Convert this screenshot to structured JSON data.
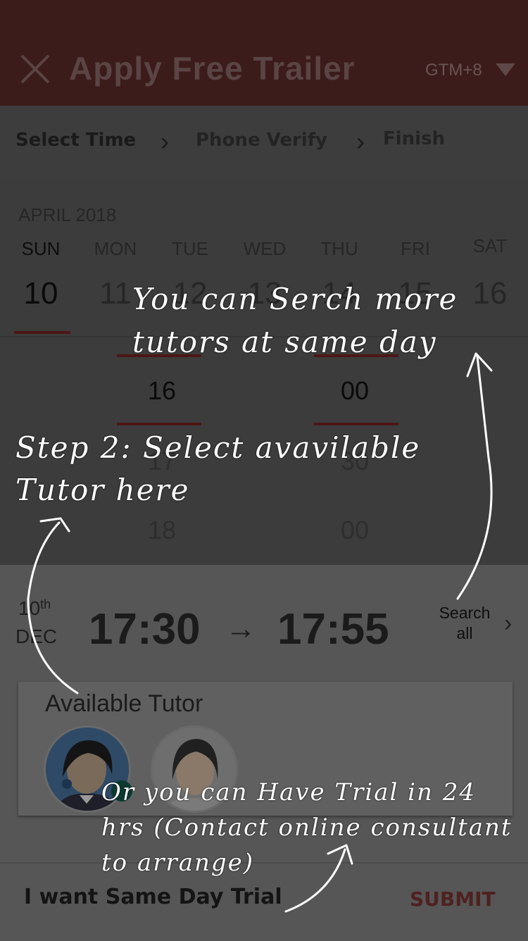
{
  "header": {
    "title": "Apply Free Trailer",
    "timezone": "GTM+8",
    "close_icon": "close-icon",
    "accent": "#3c1b1b"
  },
  "steps": [
    {
      "label": "Select Time"
    },
    {
      "label": "Phone Verify"
    },
    {
      "label": "Finish"
    }
  ],
  "calendar": {
    "month": "APRIL 2018",
    "weekdays": [
      "SUN",
      "MON",
      "TUE",
      "WED",
      "THU",
      "FRI",
      "SAT"
    ],
    "dates": [
      "10",
      "11",
      "12",
      "13",
      "14",
      "15",
      "16"
    ],
    "selected_index": 0
  },
  "time_picker": {
    "hours": [
      "16",
      "17",
      "18"
    ],
    "minutes": [
      "00",
      "30",
      "00"
    ]
  },
  "selection": {
    "day": "10",
    "day_suffix": "th",
    "month": "DEC",
    "start": "17:30",
    "end": "17:55",
    "search_all": "Search all"
  },
  "tutors": {
    "title": "Available Tutor",
    "items": [
      {
        "avatar": "tutor-avatar-1"
      },
      {
        "avatar": "tutor-avatar-2"
      }
    ]
  },
  "bottom": {
    "same_day": "I want Same Day Trial",
    "submit": "SUBMIT"
  },
  "annotations": {
    "search_more": "You can Serch more tutors at same day",
    "step2": "Step 2: Select avavilable Tutor here",
    "trial24": "Or you can Have Trial in 24 hrs (Contact online consultant to arrange)"
  }
}
